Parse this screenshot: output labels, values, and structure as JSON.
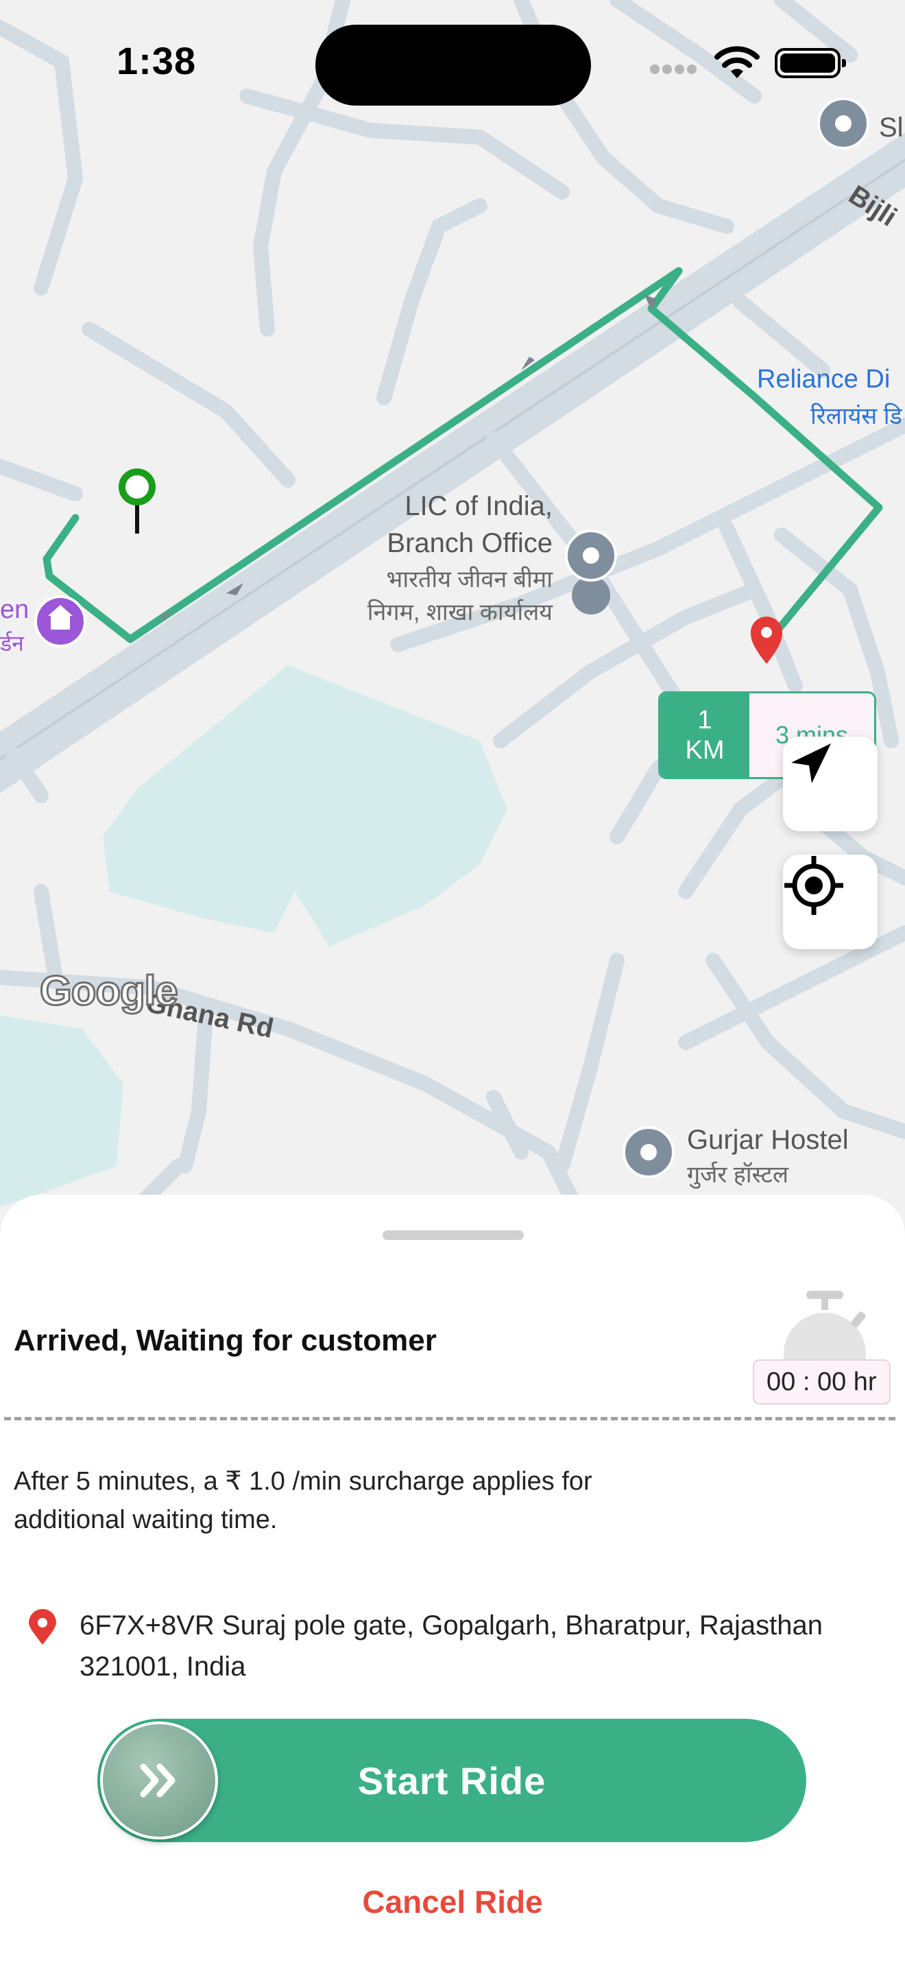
{
  "status_bar": {
    "time": "1:38"
  },
  "map": {
    "pois": {
      "reliance_en": "Reliance Di",
      "reliance_hi": "रिलायंस डि",
      "lic_en_1": "LIC of India,",
      "lic_en_2": "Branch Office",
      "lic_hi_1": "भारतीय जीवन बीमा",
      "lic_hi_2": "निगम, शाखा कार्यालय",
      "gurjar_en": "Gurjar Hostel",
      "gurjar_hi": "गुर्जर हॉस्टल",
      "left_edge_en": "en",
      "left_edge_hi": "र्डन",
      "top_right_en": "Sl",
      "top_right_road": "Bijli"
    },
    "road_label": "Ghana Rd",
    "logo": "Google",
    "eta": {
      "distance_value": "1",
      "distance_unit": "KM",
      "duration": "3 mins"
    },
    "colors": {
      "route": "#3bb086",
      "road": "#d3dbe3",
      "water": "#d6ecec",
      "pickup_pin": "#1a9e1a",
      "drop_pin": "#e53935"
    }
  },
  "sheet": {
    "status": "Arrived, Waiting for customer",
    "timer": "00 : 00 hr",
    "surcharge": "After 5 minutes, a ₹ 1.0 /min surcharge applies for additional waiting time.",
    "address": "6F7X+8VR Suraj pole gate, Gopalgarh, Bharatpur, Rajasthan 321001, India",
    "start_label": "Start Ride",
    "cancel_label": "Cancel Ride",
    "colors": {
      "accent": "#3bb086",
      "danger": "#e74a3b"
    }
  }
}
